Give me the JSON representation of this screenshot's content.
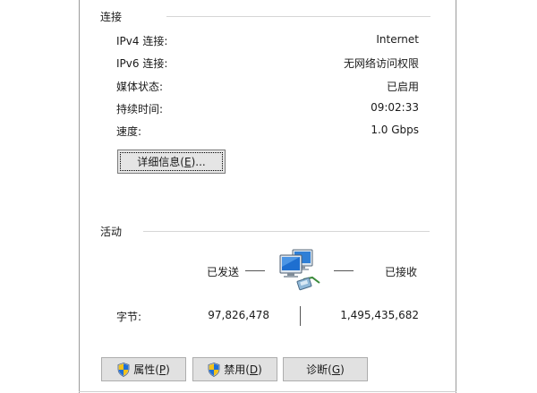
{
  "connection": {
    "title": "连接",
    "rows": [
      {
        "label": "IPv4 连接:",
        "value": "Internet"
      },
      {
        "label": "IPv6 连接:",
        "value": "无网络访问权限"
      },
      {
        "label": "媒体状态:",
        "value": "已启用"
      },
      {
        "label": "持续时间:",
        "value": "09:02:33"
      },
      {
        "label": "速度:",
        "value": "1.0 Gbps"
      }
    ],
    "details_button": {
      "text": "详细信息(",
      "key": "E",
      "suffix": ")..."
    }
  },
  "activity": {
    "title": "活动",
    "sent_label": "已发送",
    "received_label": "已接收",
    "bytes_label": "字节:",
    "bytes_sent": "97,826,478",
    "bytes_received": "1,495,435,682"
  },
  "buttons": {
    "properties": {
      "text": "属性(",
      "key": "P",
      "suffix": ")"
    },
    "disable": {
      "text": "禁用(",
      "key": "D",
      "suffix": ")"
    },
    "diagnose": {
      "text": "诊断(",
      "key": "G",
      "suffix": ")"
    }
  },
  "icons": {
    "network": "network-computers-icon",
    "shield": "uac-shield-icon"
  },
  "colors": {
    "button_face": "#e1e1e1",
    "button_border": "#adadad",
    "group_line": "#d6d6d6"
  }
}
